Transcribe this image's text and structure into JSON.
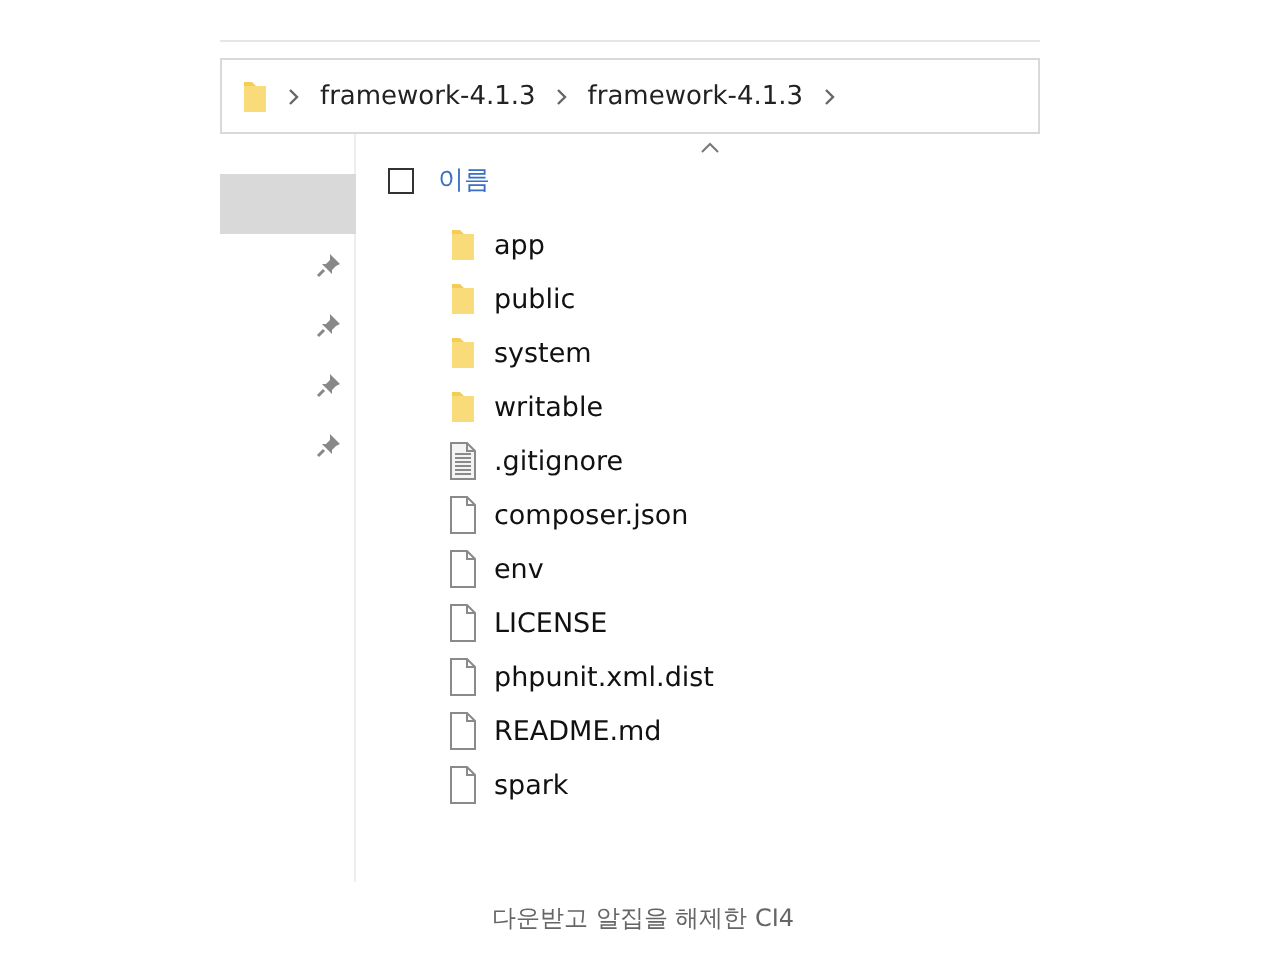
{
  "address_bar": {
    "crumbs": [
      "framework-4.1.3",
      "framework-4.1.3"
    ]
  },
  "nav_items": [
    {
      "selected": true,
      "pinned": false
    },
    {
      "selected": false,
      "pinned": true
    },
    {
      "selected": false,
      "pinned": true
    },
    {
      "selected": false,
      "pinned": true
    },
    {
      "selected": false,
      "pinned": true
    }
  ],
  "column_header": {
    "label": "이름",
    "checked": false
  },
  "files": [
    {
      "name": "app",
      "kind": "folder"
    },
    {
      "name": "public",
      "kind": "folder"
    },
    {
      "name": "system",
      "kind": "folder"
    },
    {
      "name": "writable",
      "kind": "folder"
    },
    {
      "name": ".gitignore",
      "kind": "text"
    },
    {
      "name": "composer.json",
      "kind": "file"
    },
    {
      "name": "env",
      "kind": "file"
    },
    {
      "name": "LICENSE",
      "kind": "file"
    },
    {
      "name": "phpunit.xml.dist",
      "kind": "file"
    },
    {
      "name": "README.md",
      "kind": "file"
    },
    {
      "name": "spark",
      "kind": "file"
    }
  ],
  "caption": "다운받고 알집을 해제한 CI4"
}
